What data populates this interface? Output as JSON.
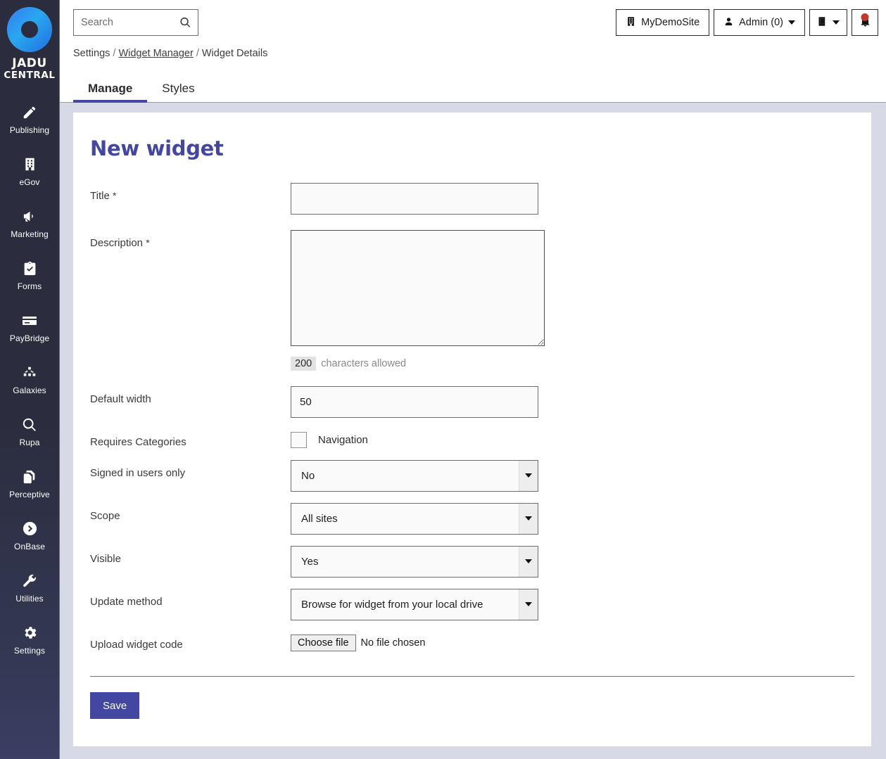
{
  "sidebar": {
    "logo": {
      "line1": "JADU",
      "line2": "CENTRAL",
      "icon": "jadu-ring-logo"
    },
    "items": [
      {
        "label": "Publishing",
        "icon": "pencil-icon"
      },
      {
        "label": "eGov",
        "icon": "building-icon"
      },
      {
        "label": "Marketing",
        "icon": "megaphone-icon"
      },
      {
        "label": "Forms",
        "icon": "clipboard-check-icon"
      },
      {
        "label": "PayBridge",
        "icon": "credit-card-icon"
      },
      {
        "label": "Galaxies",
        "icon": "sitemap-icon"
      },
      {
        "label": "Rupa",
        "icon": "magnifier-icon"
      },
      {
        "label": "Perceptive",
        "icon": "documents-copy-icon"
      },
      {
        "label": "OnBase",
        "icon": "circle-arrow-right-icon"
      },
      {
        "label": "Utilities",
        "icon": "wrench-icon"
      },
      {
        "label": "Settings",
        "icon": "gear-icon"
      }
    ]
  },
  "topbar": {
    "search": {
      "value": "",
      "placeholder": "Search",
      "icon": "search-icon"
    },
    "site_button": {
      "label": "MyDemoSite",
      "icon": "building-icon"
    },
    "admin_button": {
      "label": "Admin (0)",
      "icon": "user-icon",
      "caret": "chevron-down-icon"
    },
    "book_button": {
      "icon": "book-icon",
      "caret": "chevron-down-icon"
    },
    "notifications_button": {
      "icon": "bell-icon",
      "badge_color": "#c0392b"
    }
  },
  "breadcrumb": {
    "items": [
      {
        "label": "Settings",
        "link": false
      },
      {
        "label": "Widget Manager",
        "link": true
      },
      {
        "label": "Widget Details",
        "link": false
      }
    ],
    "separator": "/"
  },
  "tabs": {
    "items": [
      {
        "label": "Manage",
        "active": true
      },
      {
        "label": "Styles",
        "active": false
      }
    ],
    "accent_color": "#4347a2"
  },
  "page": {
    "title": "New widget",
    "title_color": "#4347a2",
    "background_color": "#d7d9e6"
  },
  "form": {
    "title_field": {
      "label": "Title",
      "required": "*",
      "value": "",
      "placeholder": ""
    },
    "description_field": {
      "label": "Description",
      "required": "*",
      "value": "",
      "placeholder": "",
      "helper_count": "200",
      "helper_text": "characters allowed"
    },
    "default_width": {
      "label": "Default width",
      "value": "50"
    },
    "requires_categories": {
      "label": "Requires Categories",
      "checkbox_label": "Navigation",
      "checked": false
    },
    "signed_in_users_only": {
      "label": "Signed in users only",
      "value": "No",
      "options": [
        "No",
        "Yes"
      ]
    },
    "scope": {
      "label": "Scope",
      "value": "All sites",
      "options": [
        "All sites"
      ]
    },
    "visible": {
      "label": "Visible",
      "value": "Yes",
      "options": [
        "Yes",
        "No"
      ]
    },
    "update_method": {
      "label": "Update method",
      "value": "Browse for widget from your local drive",
      "options": [
        "Browse for widget from your local drive"
      ]
    },
    "upload_widget_code": {
      "label": "Upload widget code",
      "button_label": "Choose file",
      "file_status": "No file chosen"
    },
    "save_button": {
      "label": "Save",
      "color": "#4347a2"
    }
  }
}
